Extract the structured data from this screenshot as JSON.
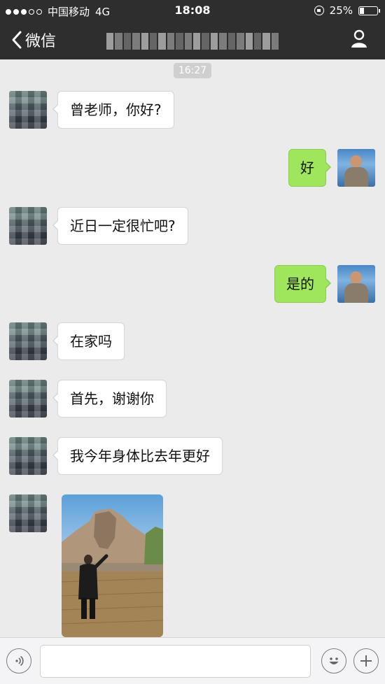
{
  "status_bar": {
    "carrier": "中国移动",
    "network": "4G",
    "time": "18:08",
    "battery": "25%",
    "battery_level": 0.25
  },
  "nav": {
    "back_label": "微信"
  },
  "chat": {
    "timestamp": "16:27",
    "messages": [
      {
        "side": "left",
        "text": "曾老师，你好?"
      },
      {
        "side": "right",
        "text": "好"
      },
      {
        "side": "left",
        "text": "近日一定很忙吧?"
      },
      {
        "side": "right",
        "text": "是的"
      },
      {
        "side": "left",
        "text": "在家吗"
      },
      {
        "side": "left",
        "text": "首先，谢谢你"
      },
      {
        "side": "left",
        "text": "我今年身体比去年更好"
      },
      {
        "side": "left",
        "type": "image"
      }
    ]
  },
  "input_bar": {
    "value": ""
  },
  "colors": {
    "nav_bg": "#2e2e2e",
    "chat_bg": "#ebebeb",
    "bubble_right": "#9fe65c",
    "bubble_left": "#ffffff"
  },
  "icons": [
    "back-chevron-icon",
    "profile-icon",
    "voice-icon",
    "emoji-icon",
    "plus-icon",
    "lock-rotation-icon",
    "battery-icon"
  ]
}
